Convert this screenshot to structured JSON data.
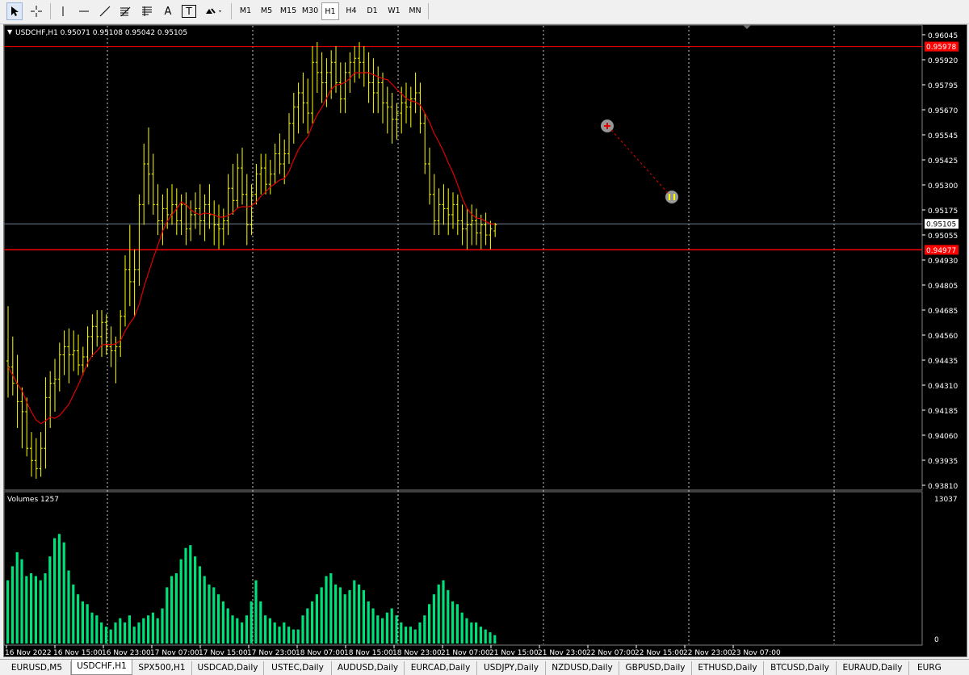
{
  "toolbar": {
    "tools": [
      "cursor-icon",
      "crosshair-icon",
      "vertical-line-icon",
      "horizontal-line-icon",
      "trendline-icon",
      "fibonacci-icon",
      "channel-icon",
      "text-icon",
      "text-label-icon",
      "shapes-icon"
    ],
    "text_tool_label": "A",
    "label_tool_label": "T",
    "timeframes": [
      "M1",
      "M5",
      "M15",
      "M30",
      "H1",
      "H4",
      "D1",
      "W1",
      "MN"
    ],
    "active_timeframe": "H1"
  },
  "chart": {
    "info": "USDCHF,H1  0.95071 0.95108 0.95042 0.95105",
    "volumes_label": "Volumes 1257",
    "volume_max_label": "13037",
    "volume_zero_label": "0",
    "price_labels": [
      "0.96045",
      "0.95920",
      "0.95795",
      "0.95670",
      "0.95545",
      "0.95425",
      "0.95300",
      "0.95175",
      "0.95055",
      "0.94930",
      "0.94805",
      "0.94685",
      "0.94560",
      "0.94435",
      "0.94310",
      "0.94185",
      "0.94060",
      "0.93935",
      "0.93810"
    ],
    "upper_level_label": "0.95978",
    "current_price_label": "0.95105",
    "lower_level_label": "0.94977",
    "time_labels": [
      "16 Nov 2022",
      "16 Nov 15:00",
      "16 Nov 23:00",
      "17 Nov 07:00",
      "17 Nov 15:00",
      "17 Nov 23:00",
      "18 Nov 07:00",
      "18 Nov 15:00",
      "18 Nov 23:00",
      "21 Nov 07:00",
      "21 Nov 15:00",
      "21 Nov 23:00",
      "22 Nov 07:00",
      "22 Nov 15:00",
      "22 Nov 23:00",
      "23 Nov 07:00"
    ],
    "colors": {
      "background": "#000000",
      "bars": "#ffff00",
      "moving_average": "#e00000",
      "level_lines": "#ff0000",
      "current_price_line": "#708090",
      "volumes": "#00e07a",
      "grid": "#ffffff",
      "axis_text": "#ffffff"
    }
  },
  "tabs": [
    "EURUSD,M5",
    "USDCHF,H1",
    "SPX500,H1",
    "USDCAD,Daily",
    "USTEC,Daily",
    "AUDUSD,Daily",
    "EURCAD,Daily",
    "USDJPY,Daily",
    "NZDUSD,Daily",
    "GBPUSD,Daily",
    "ETHUSD,Daily",
    "BTCUSD,Daily",
    "EURAUD,Daily",
    "EURG"
  ],
  "active_tab": "USDCHF,H1",
  "chart_data": {
    "type": "bar",
    "symbol": "USDCHF",
    "timeframe": "H1",
    "ylim": [
      0.9381,
      0.9606
    ],
    "levels": [
      0.95978,
      0.94977
    ],
    "current_price": 0.95105,
    "x_ticks": [
      "16 Nov 2022",
      "16 Nov 15:00",
      "16 Nov 23:00",
      "17 Nov 07:00",
      "17 Nov 15:00",
      "17 Nov 23:00",
      "18 Nov 07:00",
      "18 Nov 15:00",
      "18 Nov 23:00",
      "21 Nov 07:00",
      "21 Nov 15:00",
      "21 Nov 23:00",
      "22 Nov 07:00",
      "22 Nov 15:00",
      "22 Nov 23:00",
      "23 Nov 07:00"
    ],
    "ohlc": [
      [
        0.9443,
        0.947,
        0.9425,
        0.944
      ],
      [
        0.944,
        0.9455,
        0.9426,
        0.9432
      ],
      [
        0.9432,
        0.9446,
        0.941,
        0.9423
      ],
      [
        0.9423,
        0.943,
        0.94,
        0.9418
      ],
      [
        0.9418,
        0.9425,
        0.9396,
        0.94
      ],
      [
        0.94,
        0.9408,
        0.9386,
        0.9394
      ],
      [
        0.9394,
        0.9405,
        0.9385,
        0.939
      ],
      [
        0.939,
        0.9408,
        0.9386,
        0.94
      ],
      [
        0.94,
        0.9435,
        0.939,
        0.9425
      ],
      [
        0.9425,
        0.9438,
        0.941,
        0.9432
      ],
      [
        0.9432,
        0.9444,
        0.9418,
        0.9434
      ],
      [
        0.9434,
        0.9452,
        0.9428,
        0.9446
      ],
      [
        0.9446,
        0.9458,
        0.9436,
        0.945
      ],
      [
        0.945,
        0.9459,
        0.9432,
        0.9446
      ],
      [
        0.9446,
        0.9458,
        0.9438,
        0.9448
      ],
      [
        0.9448,
        0.9456,
        0.9436,
        0.9441
      ],
      [
        0.9441,
        0.945,
        0.9436,
        0.9445
      ],
      [
        0.9445,
        0.946,
        0.944,
        0.9455
      ],
      [
        0.9455,
        0.9466,
        0.9445,
        0.946
      ],
      [
        0.946,
        0.9468,
        0.945,
        0.9455
      ],
      [
        0.9455,
        0.9468,
        0.9445,
        0.9462
      ],
      [
        0.9462,
        0.9466,
        0.9446,
        0.945
      ],
      [
        0.945,
        0.946,
        0.944,
        0.9448
      ],
      [
        0.9448,
        0.9455,
        0.9432,
        0.945
      ],
      [
        0.945,
        0.9468,
        0.9445,
        0.9465
      ],
      [
        0.9465,
        0.9495,
        0.946,
        0.9488
      ],
      [
        0.9488,
        0.951,
        0.947,
        0.9482
      ],
      [
        0.9482,
        0.9498,
        0.9465,
        0.9488
      ],
      [
        0.9488,
        0.9525,
        0.948,
        0.952
      ],
      [
        0.952,
        0.955,
        0.951,
        0.954
      ],
      [
        0.954,
        0.9558,
        0.952,
        0.9535
      ],
      [
        0.9535,
        0.9545,
        0.9515,
        0.952
      ],
      [
        0.952,
        0.953,
        0.9505,
        0.9512
      ],
      [
        0.9512,
        0.9525,
        0.95,
        0.9518
      ],
      [
        0.9518,
        0.9528,
        0.9508,
        0.9515
      ],
      [
        0.9515,
        0.953,
        0.951,
        0.952
      ],
      [
        0.952,
        0.9528,
        0.9505,
        0.9512
      ],
      [
        0.9512,
        0.9525,
        0.9505,
        0.952
      ],
      [
        0.952,
        0.9526,
        0.95,
        0.9508
      ],
      [
        0.9508,
        0.9522,
        0.9502,
        0.9515
      ],
      [
        0.9515,
        0.9526,
        0.9508,
        0.9518
      ],
      [
        0.9518,
        0.953,
        0.9505,
        0.9512
      ],
      [
        0.9512,
        0.9525,
        0.9502,
        0.952
      ],
      [
        0.952,
        0.953,
        0.9508,
        0.9515
      ],
      [
        0.9515,
        0.9522,
        0.95,
        0.951
      ],
      [
        0.951,
        0.952,
        0.9498,
        0.9508
      ],
      [
        0.9508,
        0.9518,
        0.95,
        0.9512
      ],
      [
        0.9512,
        0.9535,
        0.9505,
        0.9528
      ],
      [
        0.9528,
        0.954,
        0.9515,
        0.9522
      ],
      [
        0.9522,
        0.9545,
        0.9518,
        0.9538
      ],
      [
        0.9538,
        0.9548,
        0.952,
        0.9525
      ],
      [
        0.9525,
        0.9535,
        0.95,
        0.951
      ],
      [
        0.951,
        0.953,
        0.9505,
        0.9525
      ],
      [
        0.9525,
        0.954,
        0.952,
        0.9535
      ],
      [
        0.9535,
        0.9545,
        0.9525,
        0.9538
      ],
      [
        0.9538,
        0.9545,
        0.9525,
        0.953
      ],
      [
        0.953,
        0.9542,
        0.9525,
        0.9535
      ],
      [
        0.9535,
        0.955,
        0.953,
        0.9545
      ],
      [
        0.9545,
        0.9555,
        0.9535,
        0.954
      ],
      [
        0.954,
        0.9552,
        0.953,
        0.9545
      ],
      [
        0.9545,
        0.9565,
        0.954,
        0.956
      ],
      [
        0.956,
        0.9575,
        0.955,
        0.9568
      ],
      [
        0.9568,
        0.958,
        0.9555,
        0.9575
      ],
      [
        0.9575,
        0.9585,
        0.956,
        0.957
      ],
      [
        0.957,
        0.9582,
        0.9555,
        0.9565
      ],
      [
        0.9565,
        0.9598,
        0.956,
        0.959
      ],
      [
        0.959,
        0.96,
        0.9575,
        0.9585
      ],
      [
        0.9585,
        0.9595,
        0.957,
        0.958
      ],
      [
        0.958,
        0.9592,
        0.9568,
        0.9585
      ],
      [
        0.9585,
        0.9596,
        0.9572,
        0.959
      ],
      [
        0.959,
        0.9598,
        0.9575,
        0.958
      ],
      [
        0.958,
        0.959,
        0.9565,
        0.9572
      ],
      [
        0.9572,
        0.959,
        0.9565,
        0.9585
      ],
      [
        0.9585,
        0.9595,
        0.9575,
        0.959
      ],
      [
        0.959,
        0.9598,
        0.958,
        0.9592
      ],
      [
        0.9592,
        0.96,
        0.9582,
        0.959
      ],
      [
        0.959,
        0.9598,
        0.9578,
        0.9585
      ],
      [
        0.9585,
        0.9595,
        0.957,
        0.958
      ],
      [
        0.958,
        0.9592,
        0.9565,
        0.9575
      ],
      [
        0.9575,
        0.9588,
        0.9565,
        0.958
      ],
      [
        0.958,
        0.9585,
        0.956,
        0.957
      ],
      [
        0.957,
        0.9578,
        0.9555,
        0.9568
      ],
      [
        0.9568,
        0.9575,
        0.955,
        0.9562
      ],
      [
        0.9562,
        0.957,
        0.9552,
        0.9565
      ],
      [
        0.9565,
        0.9578,
        0.9555,
        0.957
      ],
      [
        0.957,
        0.958,
        0.956,
        0.9568
      ],
      [
        0.9568,
        0.9578,
        0.9558,
        0.9572
      ],
      [
        0.9572,
        0.9585,
        0.9565,
        0.9575
      ],
      [
        0.9575,
        0.958,
        0.9555,
        0.956
      ],
      [
        0.956,
        0.9565,
        0.9535,
        0.954
      ],
      [
        0.954,
        0.9548,
        0.952,
        0.9525
      ],
      [
        0.9525,
        0.9535,
        0.9505,
        0.9512
      ],
      [
        0.9512,
        0.9528,
        0.9505,
        0.952
      ],
      [
        0.952,
        0.953,
        0.951,
        0.9518
      ],
      [
        0.9518,
        0.9528,
        0.9505,
        0.9515
      ],
      [
        0.9515,
        0.9526,
        0.9508,
        0.952
      ],
      [
        0.952,
        0.9525,
        0.9505,
        0.9512
      ],
      [
        0.9512,
        0.952,
        0.95,
        0.9508
      ],
      [
        0.9508,
        0.9518,
        0.9498,
        0.951
      ],
      [
        0.951,
        0.952,
        0.95,
        0.9512
      ],
      [
        0.9512,
        0.9518,
        0.95,
        0.9506
      ],
      [
        0.9506,
        0.9515,
        0.9498,
        0.951
      ],
      [
        0.951,
        0.9516,
        0.95,
        0.9505
      ],
      [
        0.9505,
        0.9512,
        0.9498,
        0.9508
      ],
      [
        0.9507,
        0.9511,
        0.9504,
        0.951
      ]
    ],
    "moving_average_last": 0.9512,
    "volumes_max": 13037,
    "volumes": [
      0.45,
      0.55,
      0.65,
      0.6,
      0.48,
      0.5,
      0.48,
      0.45,
      0.5,
      0.62,
      0.75,
      0.78,
      0.72,
      0.52,
      0.42,
      0.35,
      0.3,
      0.28,
      0.22,
      0.2,
      0.15,
      0.12,
      0.1,
      0.15,
      0.18,
      0.15,
      0.2,
      0.12,
      0.15,
      0.18,
      0.2,
      0.22,
      0.18,
      0.25,
      0.4,
      0.48,
      0.5,
      0.6,
      0.68,
      0.7,
      0.62,
      0.55,
      0.48,
      0.42,
      0.4,
      0.35,
      0.3,
      0.25,
      0.2,
      0.18,
      0.15,
      0.2,
      0.3,
      0.45,
      0.3,
      0.2,
      0.18,
      0.15,
      0.12,
      0.15,
      0.12,
      0.1,
      0.1,
      0.2,
      0.25,
      0.3,
      0.35,
      0.4,
      0.48,
      0.5,
      0.42,
      0.4,
      0.35,
      0.38,
      0.45,
      0.42,
      0.38,
      0.3,
      0.25,
      0.2,
      0.18,
      0.22,
      0.25,
      0.2,
      0.15,
      0.12,
      0.12,
      0.1,
      0.15,
      0.2,
      0.28,
      0.35,
      0.42,
      0.45,
      0.38,
      0.3,
      0.28,
      0.22,
      0.18,
      0.15,
      0.15,
      0.12,
      0.1,
      0.08,
      0.06
    ]
  }
}
